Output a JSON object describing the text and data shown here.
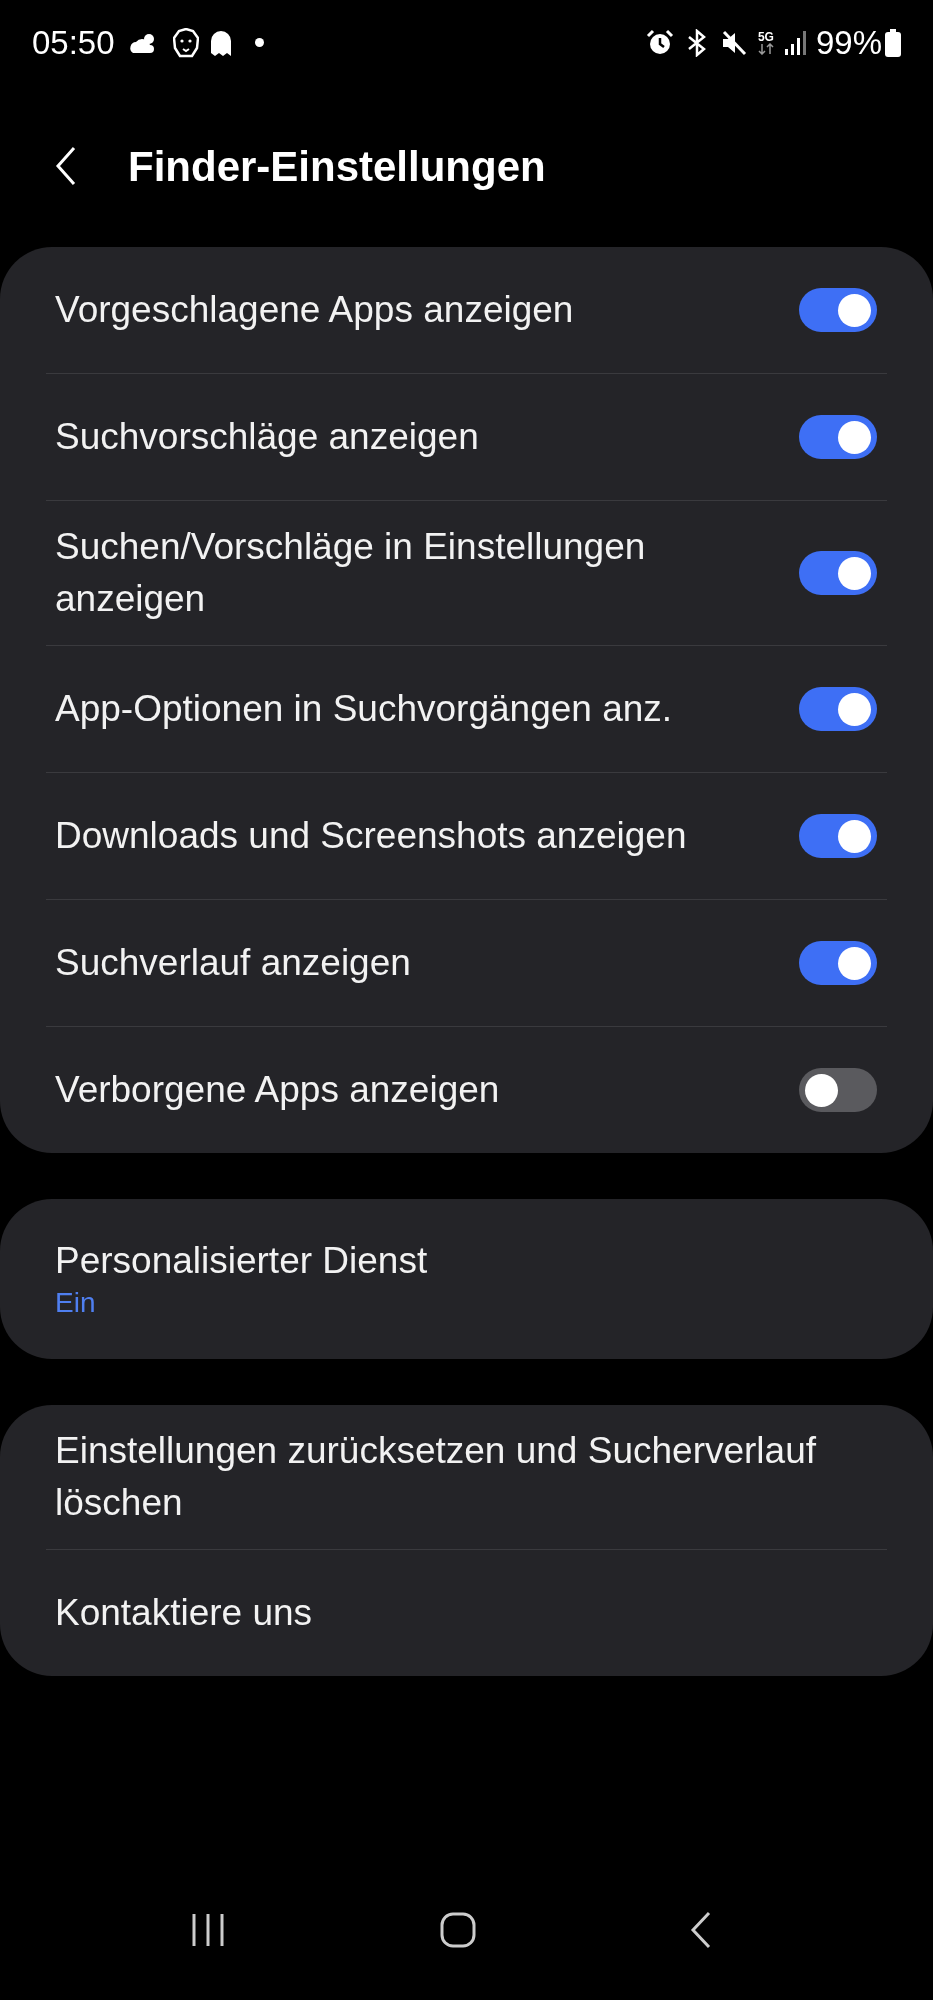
{
  "status_bar": {
    "time": "05:50",
    "network": "5G",
    "battery": "99%"
  },
  "header": {
    "title": "Finder-Einstellungen"
  },
  "toggle_card": {
    "items": [
      {
        "label": "Vorgeschlagene Apps anzeigen",
        "on": true
      },
      {
        "label": "Suchvorschläge anzeigen",
        "on": true
      },
      {
        "label": "Suchen/Vorschläge in Einstellungen anzeigen",
        "on": true
      },
      {
        "label": "App-Optionen in Suchvorgängen anz.",
        "on": true
      },
      {
        "label": "Downloads und Screenshots anzeigen",
        "on": true
      },
      {
        "label": "Suchverlauf anzeigen",
        "on": true
      },
      {
        "label": "Verborgene Apps anzeigen",
        "on": false
      }
    ]
  },
  "personal_card": {
    "title": "Personalisierter Dienst",
    "value": "Ein"
  },
  "action_card": {
    "items": [
      {
        "label": "Einstellungen zurücksetzen und Sucherverlauf löschen"
      },
      {
        "label": "Kontaktiere uns"
      }
    ]
  }
}
